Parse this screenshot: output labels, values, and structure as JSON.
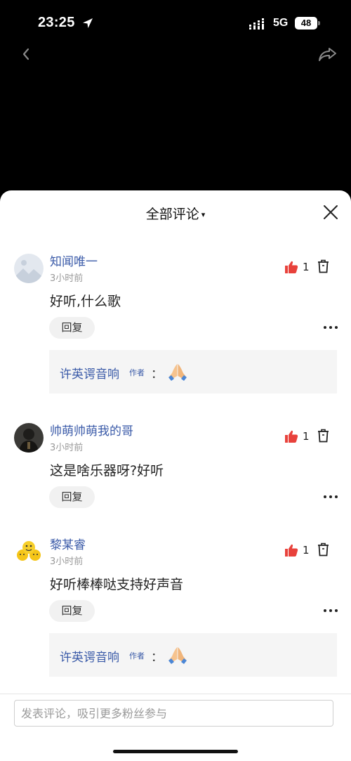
{
  "status_bar": {
    "time": "23:25",
    "network": "5G",
    "battery": "48"
  },
  "sheet": {
    "title": "全部评论",
    "caret": "▾"
  },
  "comments": [
    {
      "username": "知闻唯一",
      "time": "3小时前",
      "text": "好听,什么歌",
      "likes": "1",
      "reply_label": "回复",
      "author_reply": {
        "name": "许英谔音响",
        "tag": "作者",
        "colon": "：",
        "emoji": "folded-hands"
      }
    },
    {
      "username": "帅萌帅萌我的哥",
      "time": "3小时前",
      "text": "这是啥乐器呀?好听",
      "likes": "1",
      "reply_label": "回复"
    },
    {
      "username": "黎某睿",
      "time": "3小时前",
      "text": "好听棒棒哒支持好声音",
      "likes": "1",
      "reply_label": "回复",
      "author_reply": {
        "name": "许英谔音响",
        "tag": "作者",
        "colon": "：",
        "emoji": "folded-hands"
      }
    }
  ],
  "input": {
    "placeholder": "发表评论，吸引更多粉丝参与"
  },
  "colors": {
    "accent": "#3a5aa8",
    "like": "#e8413b"
  }
}
